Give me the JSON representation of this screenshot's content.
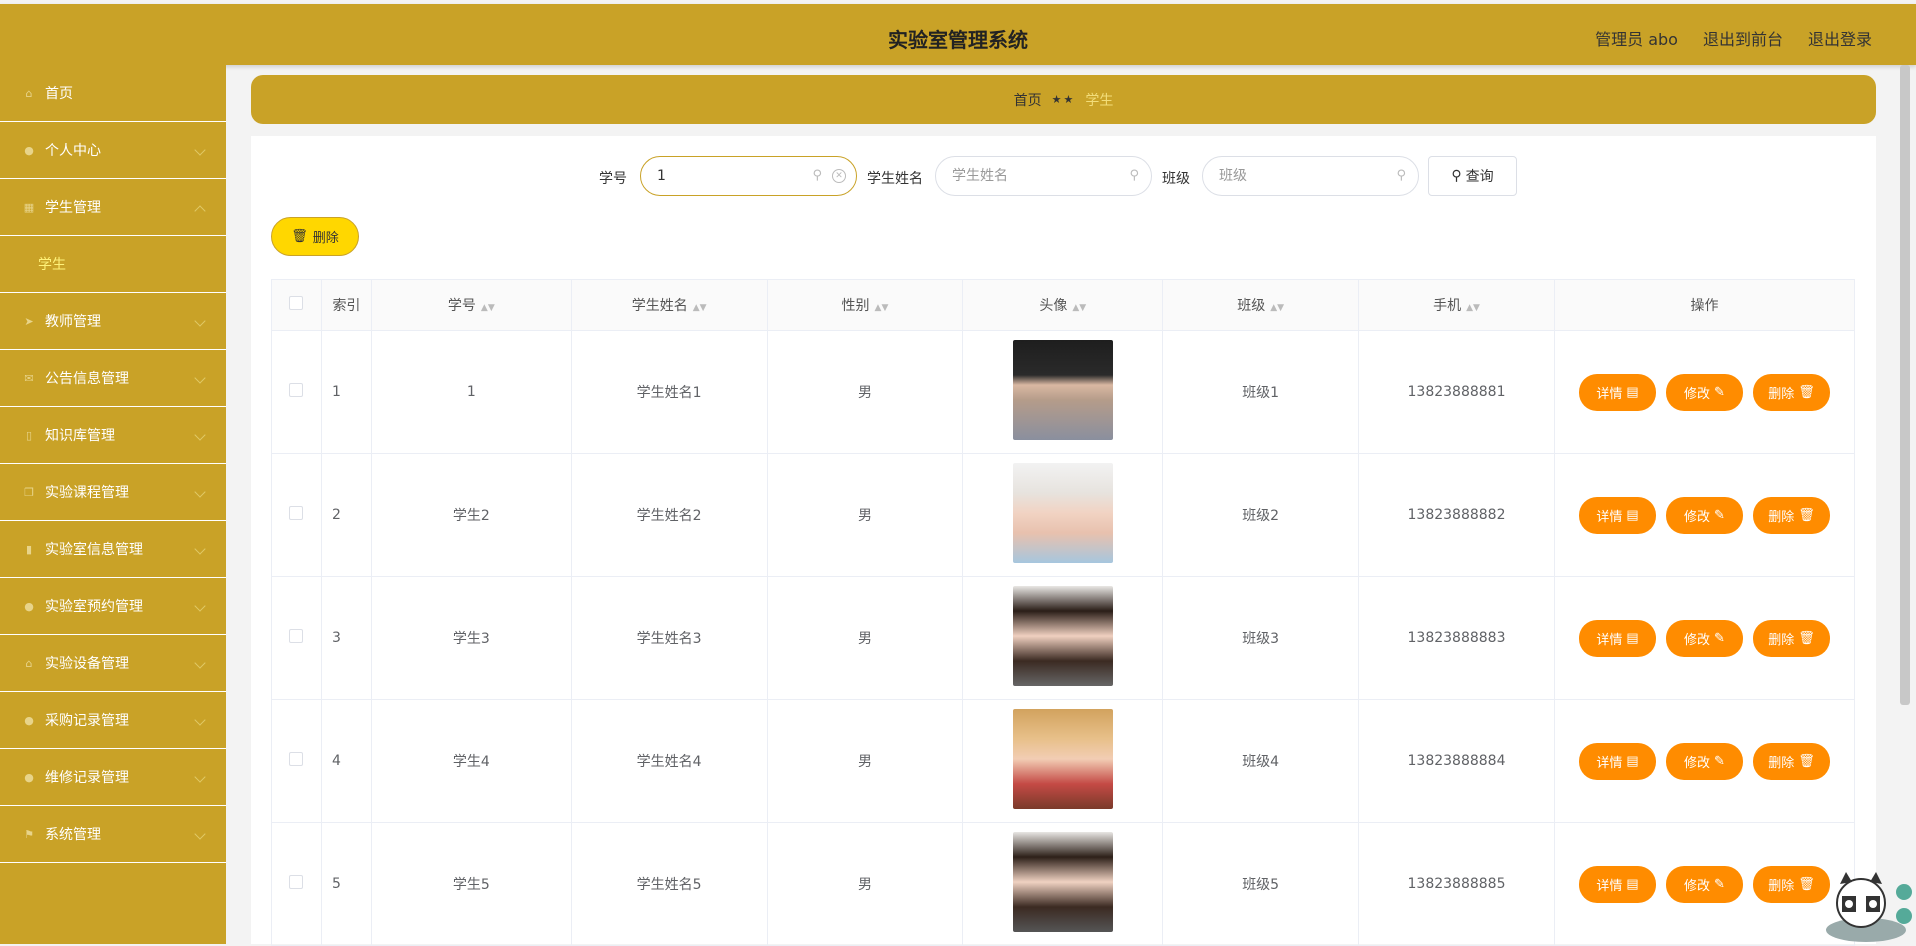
{
  "header": {
    "title": "实验室管理系统",
    "admin_label": "管理员 abo",
    "to_front_label": "退出到前台",
    "logout_label": "退出登录"
  },
  "sidebar": {
    "items": [
      {
        "label": "首页",
        "icon": "home-icon"
      },
      {
        "label": "个人中心",
        "icon": "user-icon"
      },
      {
        "label": "学生管理",
        "icon": "grid-icon"
      },
      {
        "label": "教师管理",
        "icon": "send-icon"
      },
      {
        "label": "公告信息管理",
        "icon": "mail-icon"
      },
      {
        "label": "知识库管理",
        "icon": "phone-icon"
      },
      {
        "label": "实验课程管理",
        "icon": "copy-icon"
      },
      {
        "label": "实验室信息管理",
        "icon": "chart-icon"
      },
      {
        "label": "实验室预约管理",
        "icon": "user-icon"
      },
      {
        "label": "实验设备管理",
        "icon": "bank-icon"
      },
      {
        "label": "采购记录管理",
        "icon": "pin-icon"
      },
      {
        "label": "维修记录管理",
        "icon": "user-icon"
      },
      {
        "label": "系统管理",
        "icon": "flag-icon"
      }
    ],
    "sub_item": "学生"
  },
  "breadcrumb": {
    "home": "首页",
    "separator": "★★",
    "current": "学生"
  },
  "search": {
    "id_label": "学号",
    "id_value": "1",
    "name_label": "学生姓名",
    "name_placeholder": "学生姓名",
    "class_label": "班级",
    "class_placeholder": "班级",
    "query_label": "查询"
  },
  "toolbar": {
    "delete_label": "删除"
  },
  "table": {
    "headers": [
      "索引",
      "学号",
      "学生姓名",
      "性别",
      "头像",
      "班级",
      "手机",
      "操作"
    ],
    "rows": [
      {
        "index": "1",
        "id": "1",
        "name": "学生姓名1",
        "gender": "男",
        "class": "班级1",
        "phone": "13823888881"
      },
      {
        "index": "2",
        "id": "学生2",
        "name": "学生姓名2",
        "gender": "男",
        "class": "班级2",
        "phone": "13823888882"
      },
      {
        "index": "3",
        "id": "学生3",
        "name": "学生姓名3",
        "gender": "男",
        "class": "班级3",
        "phone": "13823888883"
      },
      {
        "index": "4",
        "id": "学生4",
        "name": "学生姓名4",
        "gender": "男",
        "class": "班级4",
        "phone": "13823888884"
      },
      {
        "index": "5",
        "id": "学生5",
        "name": "学生姓名5",
        "gender": "男",
        "class": "班级5",
        "phone": "13823888885"
      }
    ],
    "actions": {
      "detail": "详情",
      "edit": "修改",
      "delete": "删除"
    }
  },
  "colors": {
    "primary": "#c9a227",
    "action": "#ff8c00",
    "delete_button": "#ffd700"
  }
}
